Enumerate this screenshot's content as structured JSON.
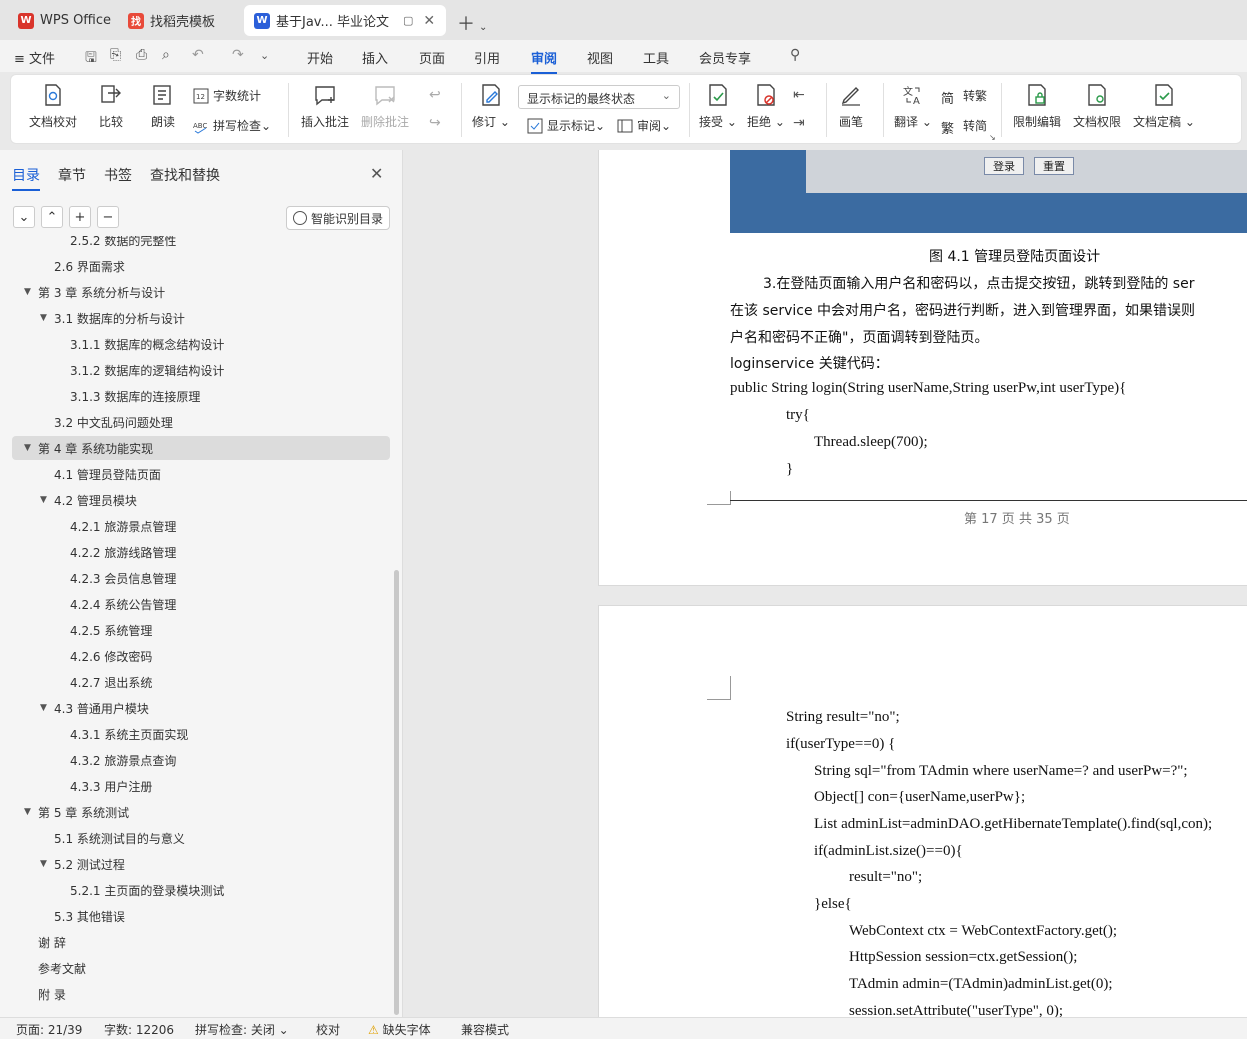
{
  "tabs": [
    {
      "icon": "W",
      "icon_color": "#d9342b",
      "label": "WPS Office"
    },
    {
      "icon": "找",
      "icon_color": "#e84a3a",
      "label": "找稻壳模板"
    },
    {
      "icon": "W",
      "icon_color": "#2b5fd9",
      "label": "基于Jav... 毕业论文"
    }
  ],
  "menu": {
    "file": "文件",
    "items": [
      "开始",
      "插入",
      "页面",
      "引用",
      "审阅",
      "视图",
      "工具",
      "会员专享"
    ],
    "active": "审阅"
  },
  "ribbon": {
    "doc_check": "文档校对",
    "compare": "比较",
    "read_aloud": "朗读",
    "word_count": "字数统计",
    "spell_check": "拼写检查",
    "insert_comment": "插入批注",
    "delete_comment": "删除批注",
    "revise": "修订",
    "markup_state": "显示标记的最终状态",
    "show_markup": "显示标记",
    "review": "审阅",
    "accept": "接受",
    "reject": "拒绝",
    "pen": "画笔",
    "translate": "翻译",
    "to_traditional": "转繁",
    "to_simplified": "转简",
    "restrict_edit": "限制编辑",
    "doc_permission": "文档权限",
    "doc_finalize": "文档定稿"
  },
  "nav": {
    "tabs": [
      "目录",
      "章节",
      "书签",
      "查找和替换"
    ],
    "smart_toc": "智能识别目录",
    "toc": [
      {
        "label": "2.5.2  数据的完整性",
        "level": 3,
        "arrow": ""
      },
      {
        "label": "2.6  界面需求",
        "level": 2,
        "arrow": ""
      },
      {
        "label": "第 3 章    系统分析与设计",
        "level": 1,
        "arrow": "▼"
      },
      {
        "label": "3.1  数据库的分析与设计",
        "level": 2,
        "arrow": "▼"
      },
      {
        "label": "3.1.1  数据库的概念结构设计",
        "level": 3,
        "arrow": ""
      },
      {
        "label": "3.1.2  数据库的逻辑结构设计",
        "level": 3,
        "arrow": ""
      },
      {
        "label": "3.1.3  数据库的连接原理",
        "level": 3,
        "arrow": ""
      },
      {
        "label": "3.2  中文乱码问题处理",
        "level": 2,
        "arrow": ""
      },
      {
        "label": "第 4 章    系统功能实现",
        "level": 1,
        "arrow": "▼",
        "selected": true
      },
      {
        "label": "4.1  管理员登陆页面",
        "level": 2,
        "arrow": ""
      },
      {
        "label": "4.2  管理员模块",
        "level": 2,
        "arrow": "▼"
      },
      {
        "label": "4.2.1  旅游景点管理",
        "level": 3,
        "arrow": ""
      },
      {
        "label": "4.2.2  旅游线路管理",
        "level": 3,
        "arrow": ""
      },
      {
        "label": "4.2.3  会员信息管理",
        "level": 3,
        "arrow": ""
      },
      {
        "label": "4.2.4  系统公告管理",
        "level": 3,
        "arrow": ""
      },
      {
        "label": "4.2.5  系统管理",
        "level": 3,
        "arrow": ""
      },
      {
        "label": "4.2.6  修改密码",
        "level": 3,
        "arrow": ""
      },
      {
        "label": "4.2.7  退出系统",
        "level": 3,
        "arrow": ""
      },
      {
        "label": "4.3  普通用户模块",
        "level": 2,
        "arrow": "▼"
      },
      {
        "label": "4.3.1  系统主页面实现",
        "level": 3,
        "arrow": ""
      },
      {
        "label": "4.3.2  旅游景点查询",
        "level": 3,
        "arrow": ""
      },
      {
        "label": "4.3.3  用户注册",
        "level": 3,
        "arrow": ""
      },
      {
        "label": "第 5 章  系统测试",
        "level": 1,
        "arrow": "▼"
      },
      {
        "label": "5.1  系统测试目的与意义",
        "level": 2,
        "arrow": ""
      },
      {
        "label": "5.2  测试过程",
        "level": 2,
        "arrow": "▼"
      },
      {
        "label": "5.2.1  主页面的登录模块测试",
        "level": 3,
        "arrow": ""
      },
      {
        "label": "5.3  其他错误",
        "level": 2,
        "arrow": ""
      },
      {
        "label": "谢    辞",
        "level": 1,
        "arrow": ""
      },
      {
        "label": "参考文献",
        "level": 1,
        "arrow": ""
      },
      {
        "label": "附    录",
        "level": 1,
        "arrow": ""
      }
    ]
  },
  "doc": {
    "login_btn": "登录",
    "reset_btn": "重置",
    "figure_caption": "图 4.1    管理员登陆页面设计",
    "page1_lines": [
      "3.在登陆页面输入用户名和密码以，点击提交按钮，跳转到登陆的 ser",
      "在该 service 中会对用户名，密码进行判断，进入到管理界面，如果错误则",
      "户名和密码不正确\"，页面调转到登陆页。",
      "loginservice 关键代码：",
      "public String login(String userName,String userPw,int userType){",
      "try{",
      "Thread.sleep(700);",
      "}"
    ],
    "page_footer": "第  17  页  共  35  页",
    "page2_lines": [
      "String result=\"no\";",
      "if(userType==0) {",
      "String sql=\"from TAdmin where userName=? and userPw=?\";",
      "Object[] con={userName,userPw};",
      "List adminList=adminDAO.getHibernateTemplate().find(sql,con);",
      "if(adminList.size()==0){",
      "result=\"no\";",
      "}else{",
      "WebContext ctx = WebContextFactory.get();",
      "HttpSession session=ctx.getSession();",
      "TAdmin admin=(TAdmin)adminList.get(0);",
      "session.setAttribute(\"userType\", 0);"
    ]
  },
  "status": {
    "page": "页面: 21/39",
    "words": "字数: 12206",
    "spell": "拼写检查: 关闭",
    "proof": "校对",
    "missing_font": "缺失字体",
    "compat": "兼容模式"
  }
}
